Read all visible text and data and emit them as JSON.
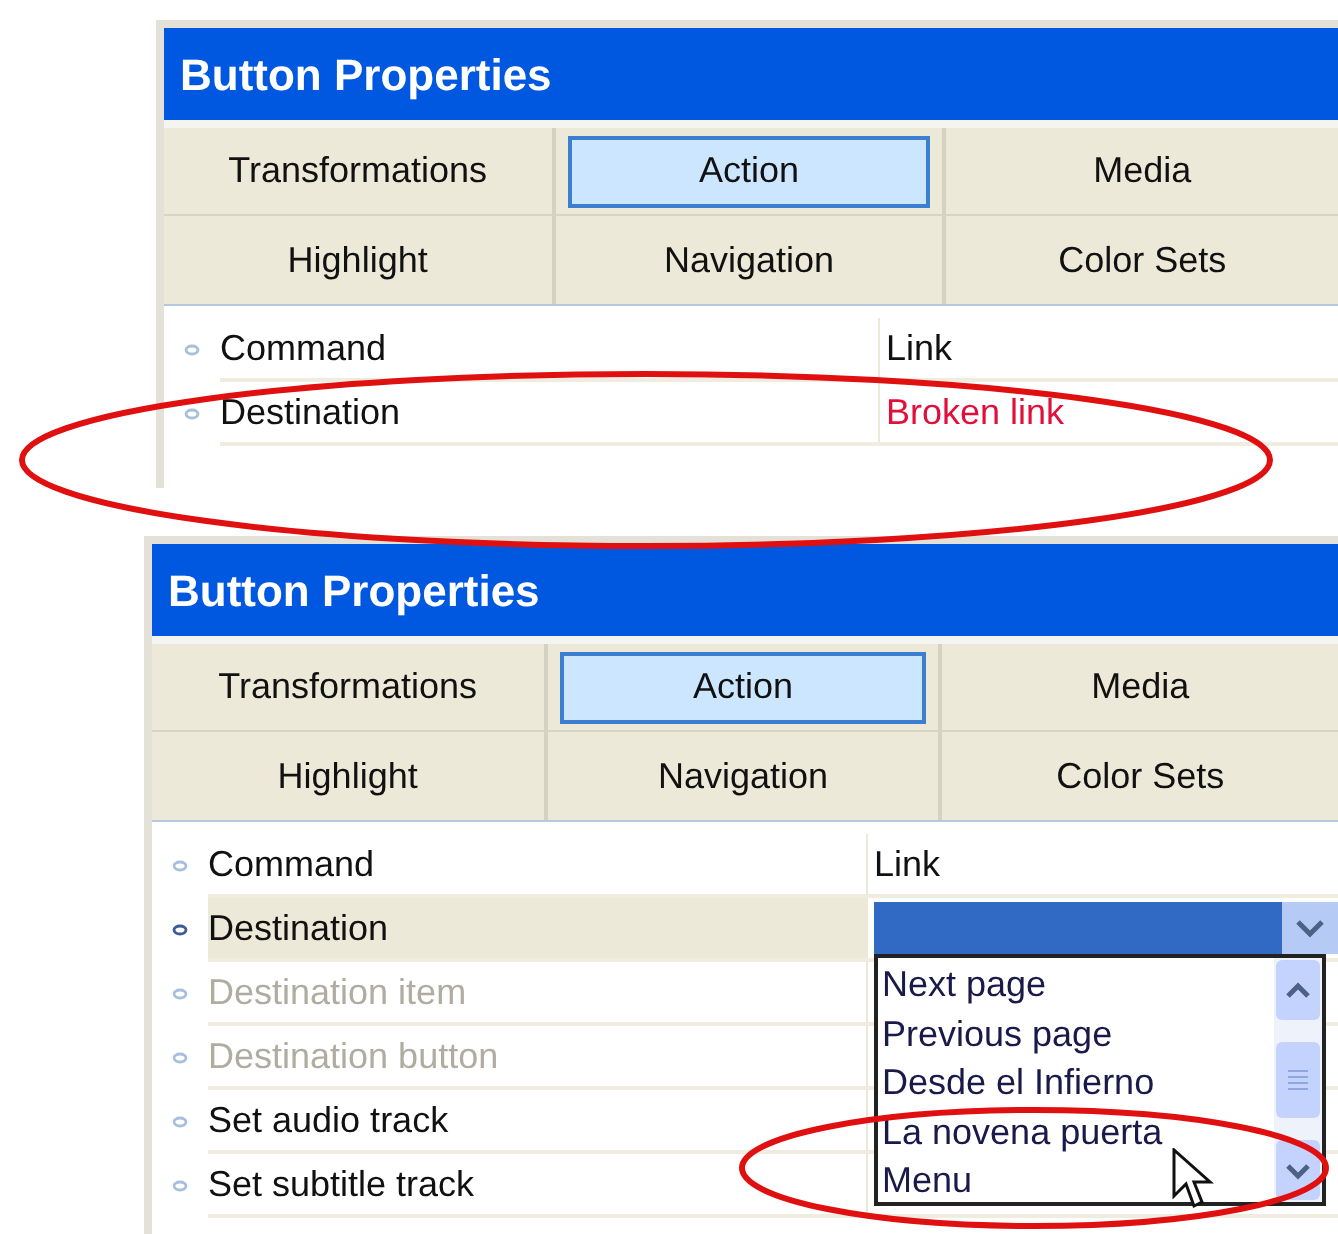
{
  "panels": [
    {
      "title": "Button Properties",
      "tabs": [
        {
          "label": "Transformations",
          "selected": false
        },
        {
          "label": "Action",
          "selected": true
        },
        {
          "label": "Media",
          "selected": false
        },
        {
          "label": "Highlight",
          "selected": false
        },
        {
          "label": "Navigation",
          "selected": false
        },
        {
          "label": "Color Sets",
          "selected": false
        }
      ],
      "properties": [
        {
          "name": "Command",
          "value": "Link",
          "kind": "text",
          "disabled": false,
          "selected": false
        },
        {
          "name": "Destination",
          "value": "Broken link",
          "kind": "error",
          "disabled": false,
          "selected": false
        }
      ]
    },
    {
      "title": "Button Properties",
      "tabs": [
        {
          "label": "Transformations",
          "selected": false
        },
        {
          "label": "Action",
          "selected": true
        },
        {
          "label": "Media",
          "selected": false
        },
        {
          "label": "Highlight",
          "selected": false
        },
        {
          "label": "Navigation",
          "selected": false
        },
        {
          "label": "Color Sets",
          "selected": false
        }
      ],
      "properties": [
        {
          "name": "Command",
          "value": "Link",
          "kind": "text",
          "disabled": false,
          "selected": false
        },
        {
          "name": "Destination",
          "kind": "dropdown",
          "disabled": false,
          "selected": true,
          "expanded": true,
          "options": [
            "Next page",
            "Previous page",
            "Desde el Infierno",
            "La novena puerta",
            "Menu"
          ]
        },
        {
          "name": "Destination item",
          "kind": "text",
          "disabled": true,
          "selected": false
        },
        {
          "name": "Destination button",
          "kind": "text",
          "disabled": true,
          "selected": false
        },
        {
          "name": "Set audio track",
          "kind": "text",
          "disabled": false,
          "selected": false
        },
        {
          "name": "Set subtitle track",
          "kind": "text",
          "disabled": false,
          "selected": false
        }
      ]
    }
  ]
}
